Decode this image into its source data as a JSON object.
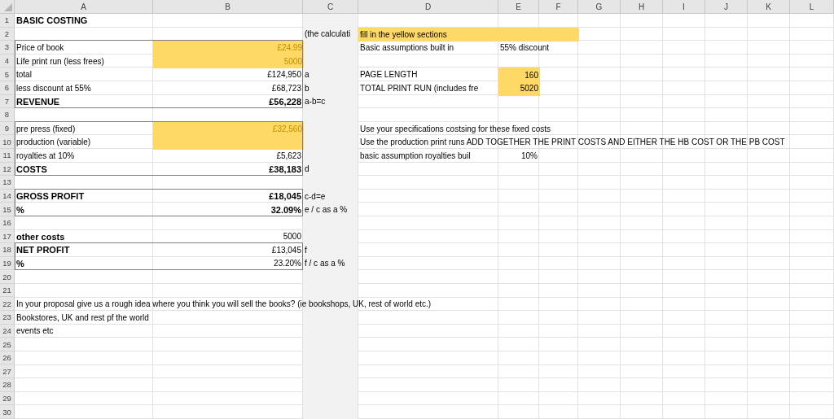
{
  "columns": [
    {
      "label": "A",
      "shaded": false
    },
    {
      "label": "B",
      "shaded": false
    },
    {
      "label": "C",
      "shaded": true
    },
    {
      "label": "D",
      "shaded": false
    },
    {
      "label": "E",
      "shaded": false
    },
    {
      "label": "F",
      "shaded": false
    },
    {
      "label": "G",
      "shaded": false
    },
    {
      "label": "H",
      "shaded": false
    },
    {
      "label": "I",
      "shaded": false
    },
    {
      "label": "J",
      "shaded": false
    },
    {
      "label": "K",
      "shaded": false
    },
    {
      "label": "L",
      "shaded": false
    }
  ],
  "rows": [
    {
      "number": "1",
      "framed": false,
      "cells": {
        "a": {
          "text": "BASIC COSTING",
          "kind": "heading",
          "highlighted": false
        }
      }
    },
    {
      "number": "2",
      "framed": false,
      "cells": {
        "c": {
          "text": "(the calculati",
          "kind": "text",
          "highlighted": false
        },
        "d": {
          "text": "fill in the yellow sections",
          "kind": "text",
          "highlighted": true
        },
        "e": {
          "kind": "text",
          "highlighted": true
        },
        "f": {
          "kind": "text",
          "highlighted": true
        }
      }
    },
    {
      "number": "3",
      "framed": true,
      "cells": {
        "a": {
          "text": "Price of book",
          "kind": "text",
          "highlighted": false
        },
        "b": {
          "text": "£24.99",
          "kind": "input",
          "highlighted": true
        },
        "d": {
          "text": "Basic assumptions built in",
          "kind": "text",
          "highlighted": false
        },
        "e": {
          "text": "55% discount",
          "kind": "text",
          "highlighted": false
        }
      }
    },
    {
      "number": "4",
      "framed": true,
      "cells": {
        "a": {
          "text": "Life print run (less frees)",
          "kind": "text",
          "highlighted": false
        },
        "b": {
          "text": "5000",
          "kind": "input",
          "highlighted": true
        }
      }
    },
    {
      "number": "5",
      "framed": true,
      "cells": {
        "a": {
          "text": "total",
          "kind": "text",
          "highlighted": false
        },
        "b": {
          "text": "£124,950",
          "kind": "number",
          "highlighted": false
        },
        "c": {
          "text": "a",
          "kind": "text",
          "highlighted": false
        },
        "d": {
          "text": "PAGE LENGTH",
          "kind": "text",
          "highlighted": false
        },
        "e": {
          "text": "160",
          "kind": "number",
          "highlighted": true
        }
      }
    },
    {
      "number": "6",
      "framed": true,
      "cells": {
        "a": {
          "text": "less discount at 55%",
          "kind": "text",
          "highlighted": false
        },
        "b": {
          "text": "£68,723",
          "kind": "number",
          "highlighted": false
        },
        "c": {
          "text": "b",
          "kind": "text",
          "highlighted": false
        },
        "d": {
          "text": "TOTAL PRINT RUN (includes fre",
          "kind": "text",
          "highlighted": false
        },
        "e": {
          "text": "5020",
          "kind": "number",
          "highlighted": true
        }
      }
    },
    {
      "number": "7",
      "framed": true,
      "cells": {
        "a": {
          "text": "REVENUE",
          "kind": "heading",
          "highlighted": false
        },
        "b": {
          "text": "£56,228",
          "kind": "total",
          "highlighted": false
        },
        "c": {
          "text": "a-b=c",
          "kind": "text",
          "highlighted": false
        }
      }
    },
    {
      "number": "8",
      "framed": false
    },
    {
      "number": "9",
      "framed": true,
      "cells": {
        "a": {
          "text": "pre press (fixed)",
          "kind": "text",
          "highlighted": false
        },
        "b": {
          "text": "£32,560",
          "kind": "input",
          "highlighted": true
        },
        "d": {
          "text": "Use your specifications costsing for these fixed costs",
          "kind": "text",
          "highlighted": false
        }
      }
    },
    {
      "number": "10",
      "framed": true,
      "cells": {
        "a": {
          "text": "production (variable)",
          "kind": "text",
          "highlighted": false
        },
        "b": {
          "kind": "input",
          "highlighted": true
        },
        "d": {
          "text": "Use the production print runs ADD TOGETHER THE PRINT COSTS AND EITHER THE HB COST OR THE PB COST",
          "kind": "text",
          "highlighted": false
        }
      }
    },
    {
      "number": "11",
      "framed": true,
      "cells": {
        "a": {
          "text": "royalties at 10%",
          "kind": "text",
          "highlighted": false
        },
        "b": {
          "text": "£5,623",
          "kind": "number",
          "highlighted": false
        },
        "d": {
          "text": "basic  assumption royalties buil",
          "kind": "text",
          "highlighted": false
        },
        "e": {
          "text": "10%",
          "kind": "number",
          "highlighted": false
        }
      }
    },
    {
      "number": "12",
      "framed": true,
      "cells": {
        "a": {
          "text": "COSTS",
          "kind": "heading",
          "highlighted": false
        },
        "b": {
          "text": "£38,183",
          "kind": "total",
          "highlighted": false
        },
        "c": {
          "text": "d",
          "kind": "text",
          "highlighted": false
        }
      }
    },
    {
      "number": "13",
      "framed": false
    },
    {
      "number": "14",
      "framed": true,
      "cells": {
        "a": {
          "text": "GROSS PROFIT",
          "kind": "heading",
          "highlighted": false
        },
        "b": {
          "text": "£18,045",
          "kind": "total",
          "highlighted": false
        },
        "c": {
          "text": "c-d=e",
          "kind": "text",
          "highlighted": false
        }
      }
    },
    {
      "number": "15",
      "framed": true,
      "cells": {
        "a": {
          "text": "%",
          "kind": "heading",
          "highlighted": false
        },
        "b": {
          "text": "32.09%",
          "kind": "total",
          "highlighted": false
        },
        "c": {
          "text": "e / c as a %",
          "kind": "text",
          "highlighted": false
        }
      }
    },
    {
      "number": "16",
      "framed": false
    },
    {
      "number": "17",
      "framed": false,
      "cells": {
        "a": {
          "text": "other costs",
          "kind": "heading",
          "highlighted": false
        },
        "b": {
          "text": "5000",
          "kind": "number",
          "highlighted": false
        }
      }
    },
    {
      "number": "18",
      "framed": true,
      "cells": {
        "a": {
          "text": "NET PROFIT",
          "kind": "heading",
          "highlighted": false
        },
        "b": {
          "text": "£13,045",
          "kind": "number",
          "highlighted": false
        },
        "c": {
          "text": "f",
          "kind": "text",
          "highlighted": false
        }
      }
    },
    {
      "number": "19",
      "framed": true,
      "cells": {
        "a": {
          "text": "%",
          "kind": "heading",
          "highlighted": false
        },
        "b": {
          "text": "23.20%",
          "kind": "number",
          "highlighted": false
        },
        "c": {
          "text": "f / c as a %",
          "kind": "text",
          "highlighted": false
        }
      }
    },
    {
      "number": "20",
      "framed": false
    },
    {
      "number": "21",
      "framed": false
    },
    {
      "number": "22",
      "framed": false,
      "cells": {
        "a": {
          "text": "In your proposal give us a rough idea where you think you will sell the books? (ie bookshops, UK, rest of world etc.)",
          "kind": "text",
          "highlighted": false
        }
      }
    },
    {
      "number": "23",
      "framed": false,
      "cells": {
        "a": {
          "text": "Bookstores, UK and rest pf the world",
          "kind": "text",
          "highlighted": false
        }
      }
    },
    {
      "number": "24",
      "framed": false,
      "cells": {
        "a": {
          "text": "events etc",
          "kind": "text",
          "highlighted": false
        }
      }
    },
    {
      "number": "25",
      "framed": false
    },
    {
      "number": "26",
      "framed": false
    },
    {
      "number": "27",
      "framed": false
    },
    {
      "number": "28",
      "framed": false
    },
    {
      "number": "29",
      "framed": false
    },
    {
      "number": "30",
      "framed": false
    }
  ]
}
